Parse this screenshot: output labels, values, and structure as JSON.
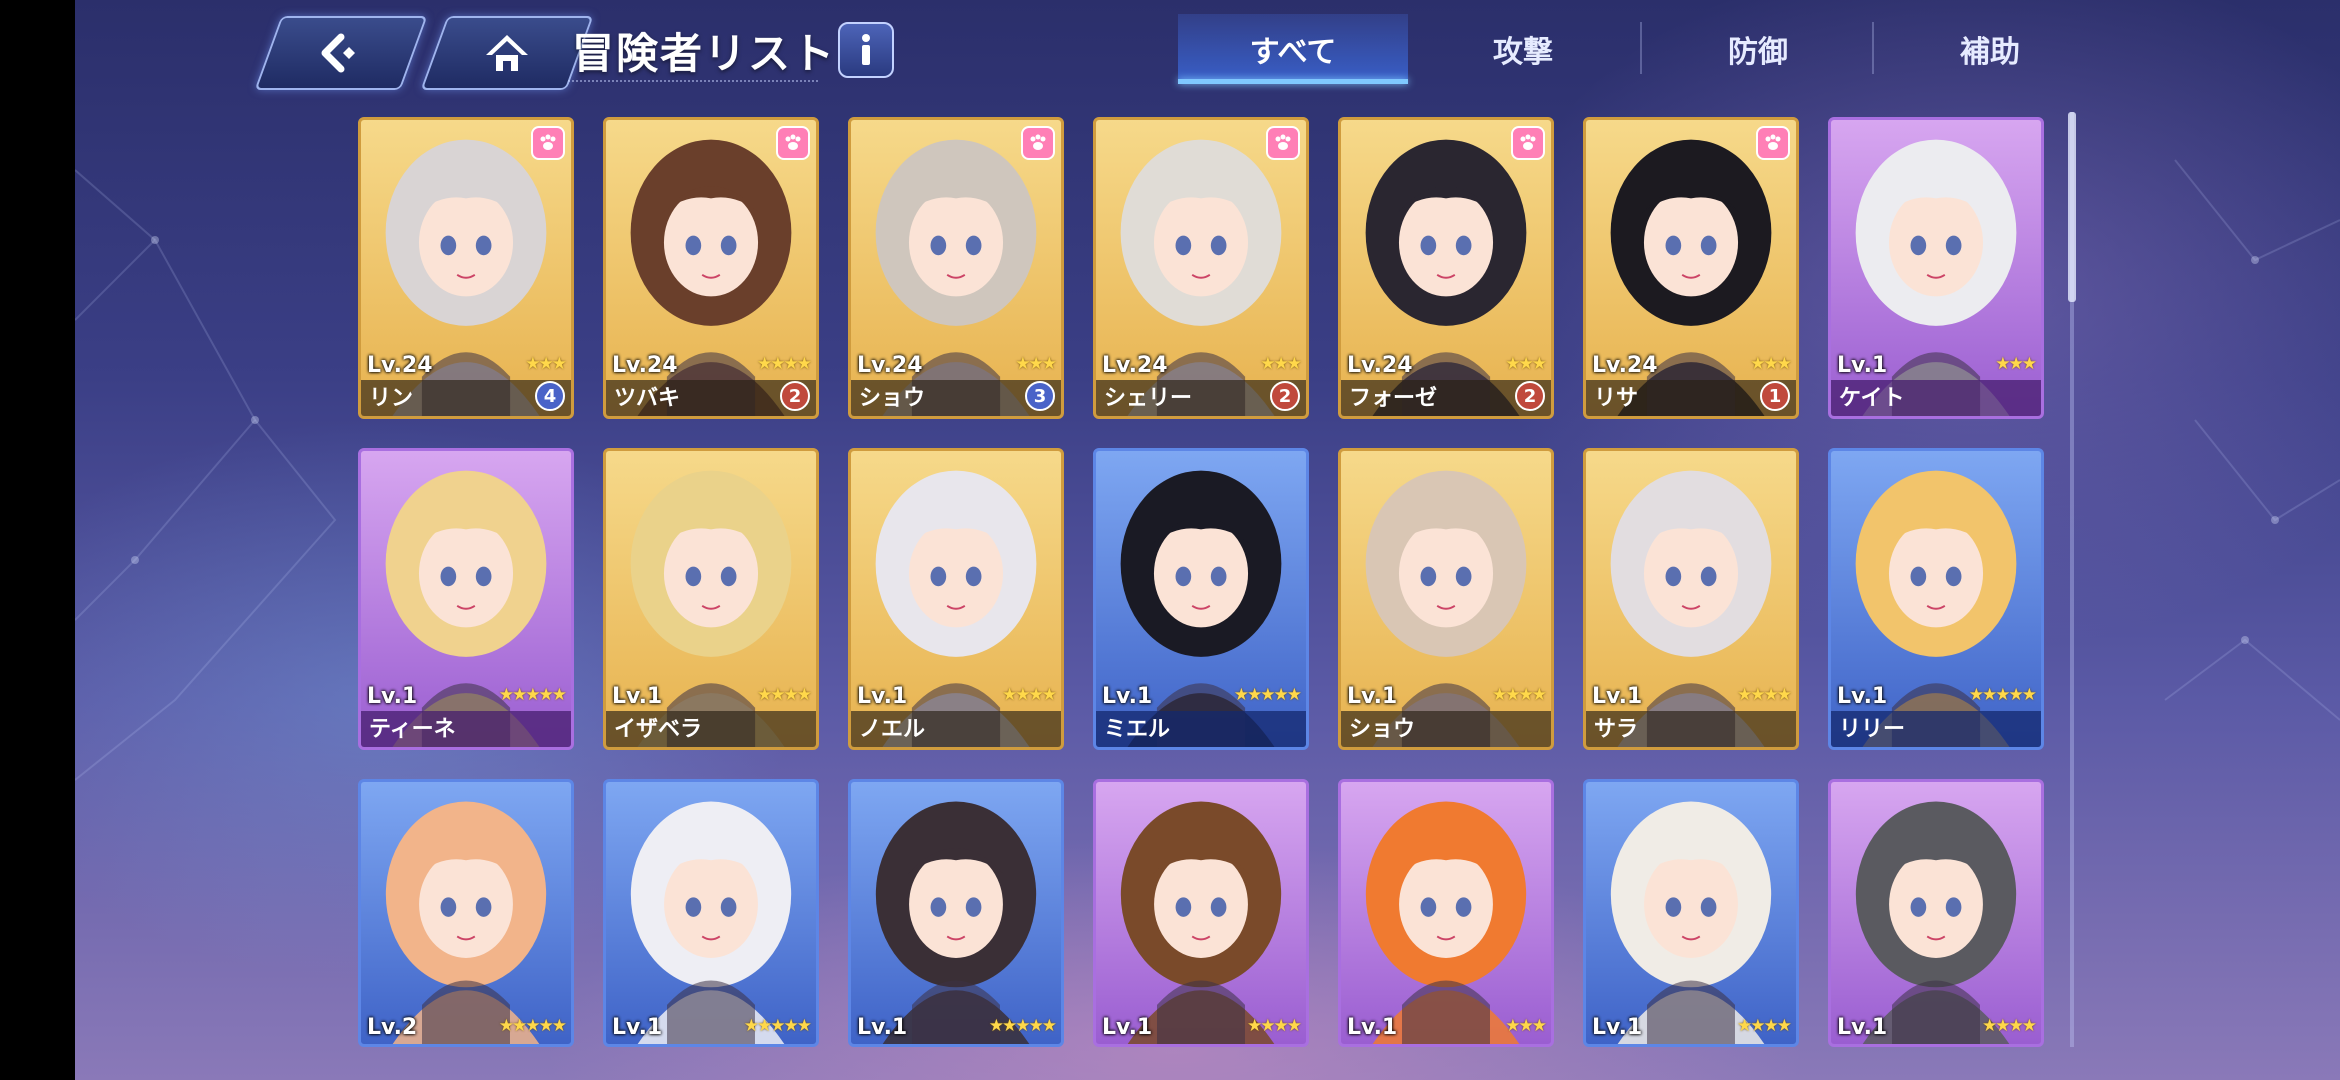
{
  "header": {
    "back_icon": "back-arrow-icon",
    "home_icon": "home-icon",
    "title": "冒険者リスト",
    "info_icon": "info-icon"
  },
  "tabs": [
    {
      "label": "すべて",
      "active": true
    },
    {
      "label": "攻撃",
      "active": false
    },
    {
      "label": "防御",
      "active": false
    },
    {
      "label": "補助",
      "active": false
    }
  ],
  "cards": [
    {
      "name": "リン",
      "level": "Lv.24",
      "stars": "★★★",
      "rarity": "gold",
      "badge": "4",
      "badge_color": "blue",
      "paw": true,
      "hair": "#d9d4d4"
    },
    {
      "name": "ツバキ",
      "level": "Lv.24",
      "stars": "★★★★",
      "rarity": "gold",
      "badge": "2",
      "badge_color": "red",
      "paw": true,
      "hair": "#6a3f2b"
    },
    {
      "name": "ショウ",
      "level": "Lv.24",
      "stars": "★★★",
      "rarity": "gold",
      "badge": "3",
      "badge_color": "blue",
      "paw": true,
      "hair": "#cfc6bd"
    },
    {
      "name": "シェリー",
      "level": "Lv.24",
      "stars": "★★★",
      "rarity": "gold",
      "badge": "2",
      "badge_color": "red",
      "paw": true,
      "hair": "#e0dcd6"
    },
    {
      "name": "フォーゼ",
      "level": "Lv.24",
      "stars": "★★★",
      "rarity": "gold",
      "badge": "2",
      "badge_color": "red",
      "paw": true,
      "hair": "#2a2630"
    },
    {
      "name": "リサ",
      "level": "Lv.24",
      "stars": "★★★",
      "rarity": "gold",
      "badge": "1",
      "badge_color": "red",
      "paw": true,
      "hair": "#1c1a20"
    },
    {
      "name": "ケイト",
      "level": "Lv.1",
      "stars": "★★★",
      "rarity": "purple",
      "badge": "",
      "badge_color": "",
      "paw": false,
      "hair": "#ececf0"
    },
    {
      "name": "ティーネ",
      "level": "Lv.1",
      "stars": "★★★★★",
      "rarity": "purple",
      "badge": "",
      "badge_color": "",
      "paw": false,
      "hair": "#f0d28e"
    },
    {
      "name": "イザベラ",
      "level": "Lv.1",
      "stars": "★★★★",
      "rarity": "gold",
      "badge": "",
      "badge_color": "",
      "paw": false,
      "hair": "#ead28a"
    },
    {
      "name": "ノエル",
      "level": "Lv.1",
      "stars": "★★★★",
      "rarity": "gold",
      "badge": "",
      "badge_color": "",
      "paw": false,
      "hair": "#e8e6ec"
    },
    {
      "name": "ミエル",
      "level": "Lv.1",
      "stars": "★★★★★",
      "rarity": "blue",
      "badge": "",
      "badge_color": "",
      "paw": false,
      "hair": "#1a1a24"
    },
    {
      "name": "ショウ",
      "level": "Lv.1",
      "stars": "★★★★",
      "rarity": "gold",
      "badge": "",
      "badge_color": "",
      "paw": false,
      "hair": "#d9c6b4"
    },
    {
      "name": "サラ",
      "level": "Lv.1",
      "stars": "★★★★",
      "rarity": "gold",
      "badge": "",
      "badge_color": "",
      "paw": false,
      "hair": "#e2dde0"
    },
    {
      "name": "リリー",
      "level": "Lv.1",
      "stars": "★★★★★",
      "rarity": "blue",
      "badge": "",
      "badge_color": "",
      "paw": false,
      "hair": "#f2c46b"
    },
    {
      "name": "",
      "level": "Lv.2",
      "stars": "★★★★★",
      "rarity": "blue",
      "badge": "",
      "badge_color": "",
      "paw": false,
      "hair": "#f2b48a"
    },
    {
      "name": "",
      "level": "Lv.1",
      "stars": "★★★★★",
      "rarity": "blue",
      "badge": "",
      "badge_color": "",
      "paw": false,
      "hair": "#eeeef4"
    },
    {
      "name": "",
      "level": "Lv.1",
      "stars": "★★★★★",
      "rarity": "blue",
      "badge": "",
      "badge_color": "",
      "paw": false,
      "hair": "#3a2f36"
    },
    {
      "name": "",
      "level": "Lv.1",
      "stars": "★★★★",
      "rarity": "purple",
      "badge": "",
      "badge_color": "",
      "paw": false,
      "hair": "#7a4a2a"
    },
    {
      "name": "",
      "level": "Lv.1",
      "stars": "★★★",
      "rarity": "purple",
      "badge": "",
      "badge_color": "",
      "paw": false,
      "hair": "#f07a30"
    },
    {
      "name": "",
      "level": "Lv.1",
      "stars": "★★★★",
      "rarity": "blue",
      "badge": "",
      "badge_color": "",
      "paw": false,
      "hair": "#f0ece6"
    },
    {
      "name": "",
      "level": "Lv.1",
      "stars": "★★★★",
      "rarity": "purple",
      "badge": "",
      "badge_color": "",
      "paw": false,
      "hair": "#5a5a60"
    }
  ]
}
